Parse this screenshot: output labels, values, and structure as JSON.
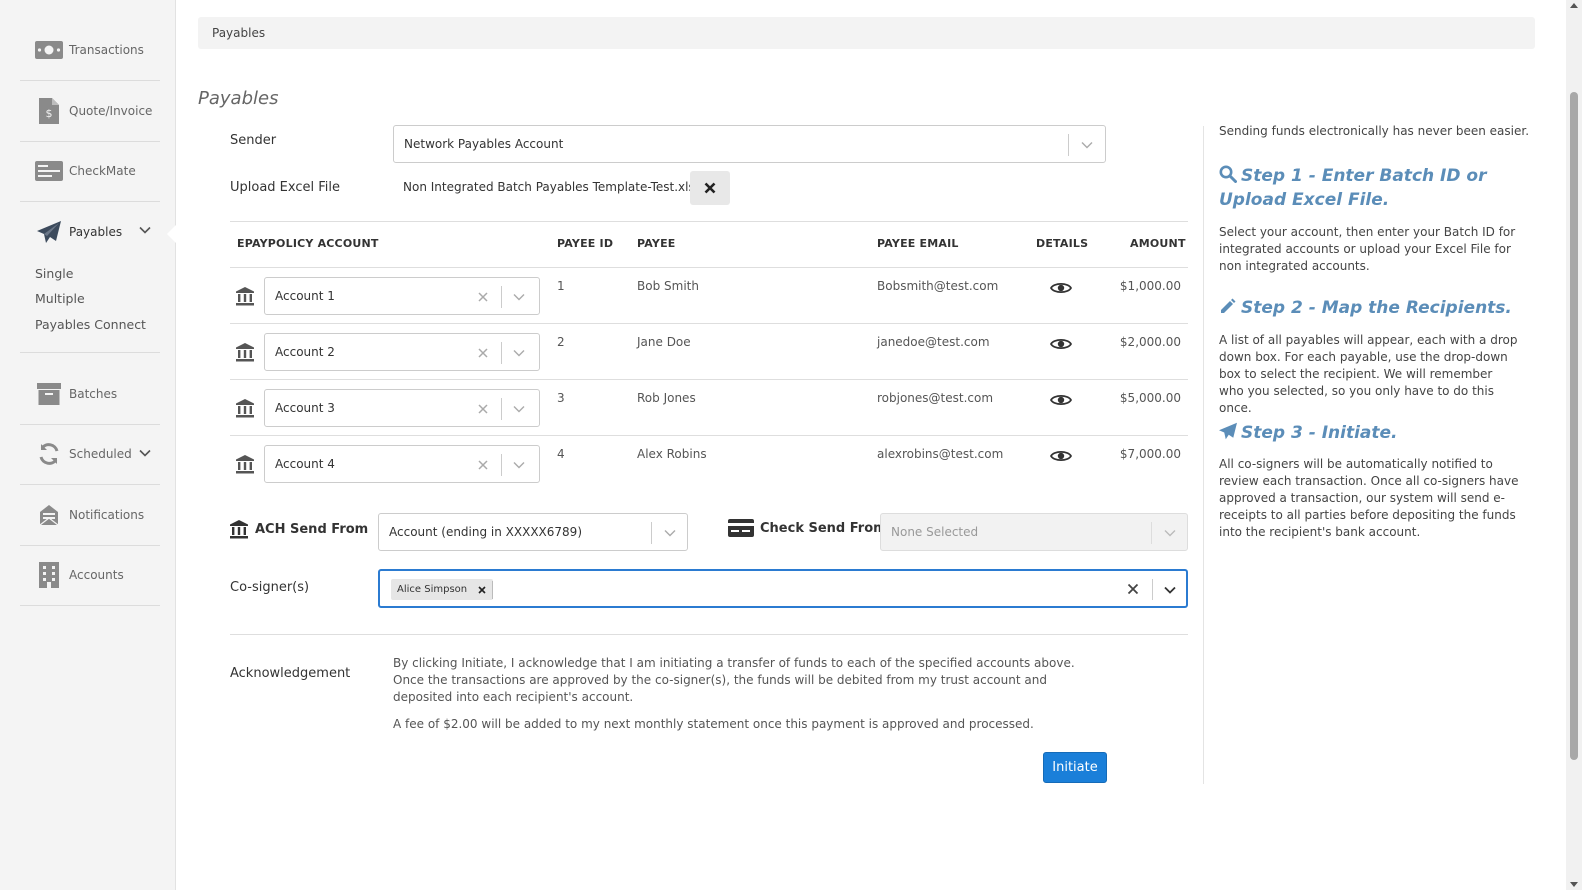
{
  "sidebar": {
    "items": [
      {
        "label": "Transactions",
        "icon": "money-icon"
      },
      {
        "label": "Quote/Invoice",
        "icon": "invoice-icon"
      },
      {
        "label": "CheckMate",
        "icon": "check-icon"
      },
      {
        "label": "Payables",
        "icon": "paper-plane-icon"
      },
      {
        "label": "Batches",
        "icon": "archive-icon"
      },
      {
        "label": "Scheduled",
        "icon": "refresh-icon"
      },
      {
        "label": "Notifications",
        "icon": "notification-icon"
      },
      {
        "label": "Accounts",
        "icon": "building-icon"
      }
    ],
    "payables_sub": [
      "Single",
      "Multiple",
      "Payables Connect"
    ]
  },
  "breadcrumb": "Payables",
  "page_title": "Payables",
  "sender": {
    "label": "Sender",
    "value": "Network Payables Account"
  },
  "upload": {
    "label": "Upload Excel File",
    "file_name": "Non Integrated Batch Payables Template-Test.xlsx"
  },
  "table": {
    "headers": {
      "account": "EPAYPOLICY ACCOUNT",
      "payee_id": "PAYEE ID",
      "payee": "PAYEE",
      "payee_email": "PAYEE EMAIL",
      "details": "DETAILS",
      "amount": "AMOUNT"
    },
    "rows": [
      {
        "account": "Account 1",
        "payee_id": "1",
        "payee": "Bob Smith",
        "email": "Bobsmith@test.com",
        "amount": "$1,000.00"
      },
      {
        "account": "Account 2",
        "payee_id": "2",
        "payee": "Jane Doe",
        "email": "janedoe@test.com",
        "amount": "$2,000.00"
      },
      {
        "account": "Account 3",
        "payee_id": "3",
        "payee": "Rob Jones",
        "email": "robjones@test.com",
        "amount": "$5,000.00"
      },
      {
        "account": "Account 4",
        "payee_id": "4",
        "payee": "Alex Robins",
        "email": "alexrobins@test.com",
        "amount": "$7,000.00"
      }
    ]
  },
  "ach": {
    "label": "ACH Send From",
    "value": "Account (ending in XXXXX6789)"
  },
  "check": {
    "label": "Check Send From",
    "value": "None Selected"
  },
  "cosigners": {
    "label": "Co-signer(s)",
    "tags": [
      "Alice Simpson"
    ]
  },
  "acknowledgement": {
    "label": "Acknowledgement",
    "text1": "By clicking Initiate, I acknowledge that I am initiating a transfer of funds to each of the specified accounts above. Once the transactions are approved by the co-signer(s), the funds will be debited from my trust account and deposited into each recipient's account.",
    "text2": "A fee of $2.00 will be added to my next monthly statement once this payment is approved and processed."
  },
  "initiate_label": "Initiate",
  "help": {
    "intro": "Sending funds electronically has never been easier.",
    "steps": [
      {
        "title": "Step 1 - Enter Batch ID or Upload Excel File.",
        "icon": "search-icon",
        "text": "Select your account, then enter your Batch ID for integrated accounts or upload your Excel File for non integrated accounts."
      },
      {
        "title": "Step 2 - Map the Recipients.",
        "icon": "pencil-icon",
        "text": "A list of all payables will appear, each with a drop down box. For each payable, use the drop-down box to select the recipient. We will remember who you selected, so you only have to do this once."
      },
      {
        "title": "Step 3 - Initiate.",
        "icon": "paper-plane-icon",
        "text": "All co-signers will be automatically notified to review each transaction. Once all co-signers have approved a transaction, our system will send e-receipts to all parties before depositing the funds into the recipient's bank account."
      }
    ]
  },
  "colors": {
    "accent": "#1a7fd9",
    "help_title": "#5b8db8",
    "sidebar_bg": "#f4f4f4"
  }
}
